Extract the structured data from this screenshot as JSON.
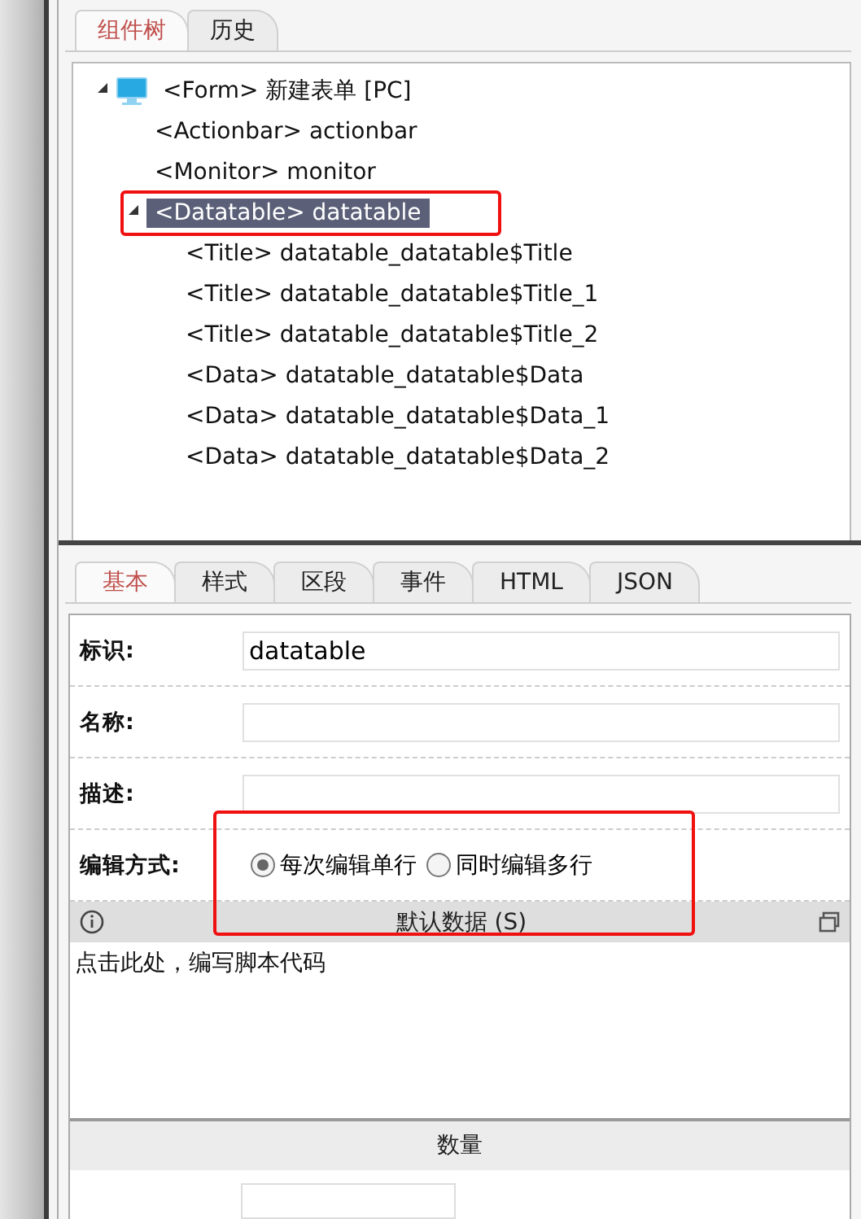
{
  "top_tabs": [
    {
      "label": "组件树",
      "selected": true
    },
    {
      "label": "历史",
      "selected": false
    }
  ],
  "tree": [
    {
      "label": "<Form> 新建表单 [PC]",
      "kind": "form",
      "expanded": true,
      "selected": false,
      "highlighted": false,
      "children": [
        {
          "label": "<Actionbar> actionbar",
          "selected": false,
          "highlighted": false
        },
        {
          "label": "<Monitor> monitor",
          "selected": false,
          "highlighted": false
        },
        {
          "label": "<Datatable> datatable",
          "selected": true,
          "highlighted": true,
          "expanded": true,
          "children": [
            {
              "label": "<Title> datatable_datatable$Title",
              "selected": false,
              "highlighted": false
            },
            {
              "label": "<Title> datatable_datatable$Title_1",
              "selected": false,
              "highlighted": false
            },
            {
              "label": "<Title> datatable_datatable$Title_2",
              "selected": false,
              "highlighted": false
            },
            {
              "label": "<Data> datatable_datatable$Data",
              "selected": false,
              "highlighted": false
            },
            {
              "label": "<Data> datatable_datatable$Data_1",
              "selected": false,
              "highlighted": false
            },
            {
              "label": "<Data> datatable_datatable$Data_2",
              "selected": false,
              "highlighted": false
            }
          ]
        }
      ]
    }
  ],
  "prop_tabs": [
    {
      "label": "基本",
      "selected": true
    },
    {
      "label": "样式",
      "selected": false
    },
    {
      "label": "区段",
      "selected": false
    },
    {
      "label": "事件",
      "selected": false
    },
    {
      "label": "HTML",
      "selected": false
    },
    {
      "label": "JSON",
      "selected": false
    }
  ],
  "fields": [
    {
      "kind": "text",
      "label": "标识:",
      "value": "datatable"
    },
    {
      "kind": "text",
      "label": "名称:"
    },
    {
      "kind": "text",
      "label": "描述:"
    },
    {
      "kind": "radio",
      "label": "编辑方式:",
      "highlighted": true,
      "options": [
        {
          "label": "每次编辑单行",
          "selected": true
        },
        {
          "label": "同时编辑多行",
          "selected": false
        }
      ]
    }
  ],
  "script_section": {
    "title": "默认数据 (S)",
    "placeholder": "点击此处，编写脚本代码"
  },
  "next_section": {
    "title": "数量"
  }
}
